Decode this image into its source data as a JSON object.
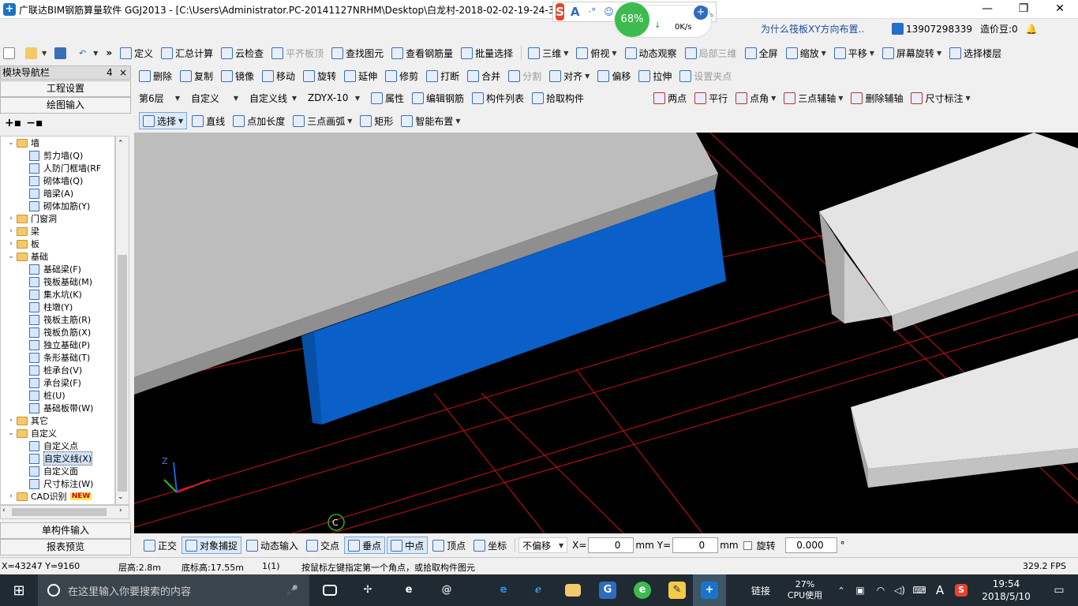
{
  "title": "广联达BIM钢筋算量软件 GGJ2013 - [C:\\Users\\Administrator.PC-20141127NRHM\\Desktop\\白龙村-2018-02-02-19-24-35",
  "window_controls": {
    "minimize": "—",
    "restore": "❐",
    "close": "✕"
  },
  "ime": {
    "logo": "S",
    "a": "A",
    "items": [
      "·°",
      "☺",
      "🎤",
      "⌨",
      "👤",
      "👕",
      "🔧"
    ]
  },
  "speed": {
    "percent": "68%",
    "rate": "0K/s"
  },
  "top_right": {
    "help_link": "为什么筏板XY方向布置..",
    "phone": "13907298339",
    "beans": "造价豆:0"
  },
  "toolbar1": {
    "items": [
      "定义",
      "汇总计算",
      "云检查",
      "平齐板顶",
      "查找图元",
      "查看钢筋量",
      "批量选择"
    ],
    "view_items": [
      "三维",
      "俯视",
      "动态观察",
      "局部三维",
      "全屏",
      "缩放",
      "平移",
      "屏幕旋转",
      "选择楼层"
    ]
  },
  "toolbar2": {
    "items": [
      "删除",
      "复制",
      "镜像",
      "移动",
      "旋转",
      "延伸",
      "修剪",
      "打断",
      "合并",
      "分割",
      "对齐",
      "偏移",
      "拉伸",
      "设置夹点"
    ]
  },
  "toolbar3": {
    "floor": "第6层",
    "category": "自定义",
    "type": "自定义线",
    "component": "ZDYX-10",
    "items": [
      "属性",
      "编辑钢筋",
      "构件列表",
      "拾取构件"
    ],
    "aux_items": [
      "两点",
      "平行",
      "点角",
      "三点辅轴",
      "删除辅轴",
      "尺寸标注"
    ]
  },
  "toolbar4": {
    "items": [
      "选择",
      "直线",
      "点加长度",
      "三点画弧",
      "矩形",
      "智能布置"
    ]
  },
  "nav": {
    "title": "模块导航栏",
    "pin": "4",
    "close": "×",
    "top_buttons": [
      "工程设置",
      "绘图输入"
    ],
    "bottom_buttons": [
      "单构件输入",
      "报表预览"
    ],
    "tree": [
      {
        "level": 0,
        "expand": "⌄",
        "folder": true,
        "label": "墙"
      },
      {
        "level": 1,
        "label": "剪力墙(Q)"
      },
      {
        "level": 1,
        "label": "人防门框墙(RF"
      },
      {
        "level": 1,
        "label": "砌体墙(Q)"
      },
      {
        "level": 1,
        "label": "暗梁(A)"
      },
      {
        "level": 1,
        "label": "砌体加筋(Y)"
      },
      {
        "level": 0,
        "expand": "›",
        "folder": true,
        "label": "门窗洞"
      },
      {
        "level": 0,
        "expand": "›",
        "folder": true,
        "label": "梁"
      },
      {
        "level": 0,
        "expand": "›",
        "folder": true,
        "label": "板"
      },
      {
        "level": 0,
        "expand": "⌄",
        "folder": true,
        "label": "基础"
      },
      {
        "level": 1,
        "label": "基础梁(F)"
      },
      {
        "level": 1,
        "label": "筏板基础(M)"
      },
      {
        "level": 1,
        "label": "集水坑(K)"
      },
      {
        "level": 1,
        "label": "柱墩(Y)"
      },
      {
        "level": 1,
        "label": "筏板主筋(R)"
      },
      {
        "level": 1,
        "label": "筏板负筋(X)"
      },
      {
        "level": 1,
        "label": "独立基础(P)"
      },
      {
        "level": 1,
        "label": "条形基础(T)"
      },
      {
        "level": 1,
        "label": "桩承台(V)"
      },
      {
        "level": 1,
        "label": "承台梁(F)"
      },
      {
        "level": 1,
        "label": "桩(U)"
      },
      {
        "level": 1,
        "label": "基础板带(W)"
      },
      {
        "level": 0,
        "expand": "›",
        "folder": true,
        "label": "其它"
      },
      {
        "level": 0,
        "expand": "⌄",
        "folder": true,
        "label": "自定义"
      },
      {
        "level": 1,
        "label": "自定义点"
      },
      {
        "level": 1,
        "label": "自定义线(X)",
        "selected": true
      },
      {
        "level": 1,
        "label": "自定义面"
      },
      {
        "level": 1,
        "label": "尺寸标注(W)"
      },
      {
        "level": 0,
        "expand": "›",
        "folder": true,
        "label": "CAD识别",
        "badge": "NEW"
      }
    ]
  },
  "viewport": {
    "axis_z": "Z",
    "origin_marker": "C"
  },
  "snapbar": {
    "items": [
      "正交",
      "对象捕捉",
      "动态输入",
      "交点",
      "垂点",
      "中点",
      "顶点",
      "坐标"
    ],
    "offset_mode": "不偏移",
    "x_label": "X=",
    "x_value": "0",
    "x_unit": "mm",
    "y_label": "Y=",
    "y_value": "0",
    "y_unit": "mm",
    "rotate_label": "旋转",
    "rotate_value": "0.000",
    "rotate_unit": "°"
  },
  "status": {
    "coords": "X=43247 Y=9160",
    "floor_height": "层高:2.8m",
    "base_height": "底标高:17.55m",
    "count": "1(1)",
    "hint": "按鼠标左键指定第一个角点，或拾取构件图元",
    "fps": "329.2 FPS"
  },
  "taskbar": {
    "search_placeholder": "在这里输入你要搜索的内容",
    "link": "链接",
    "cpu_percent": "27%",
    "cpu_label": "CPU使用",
    "time": "19:54",
    "date": "2018/5/10",
    "lang": "A"
  },
  "colors": {
    "selected_beam": "#0a5fc8",
    "slab": "#b9b9b9",
    "grid_line": "#d01010",
    "viewport_bg": "#000000"
  }
}
